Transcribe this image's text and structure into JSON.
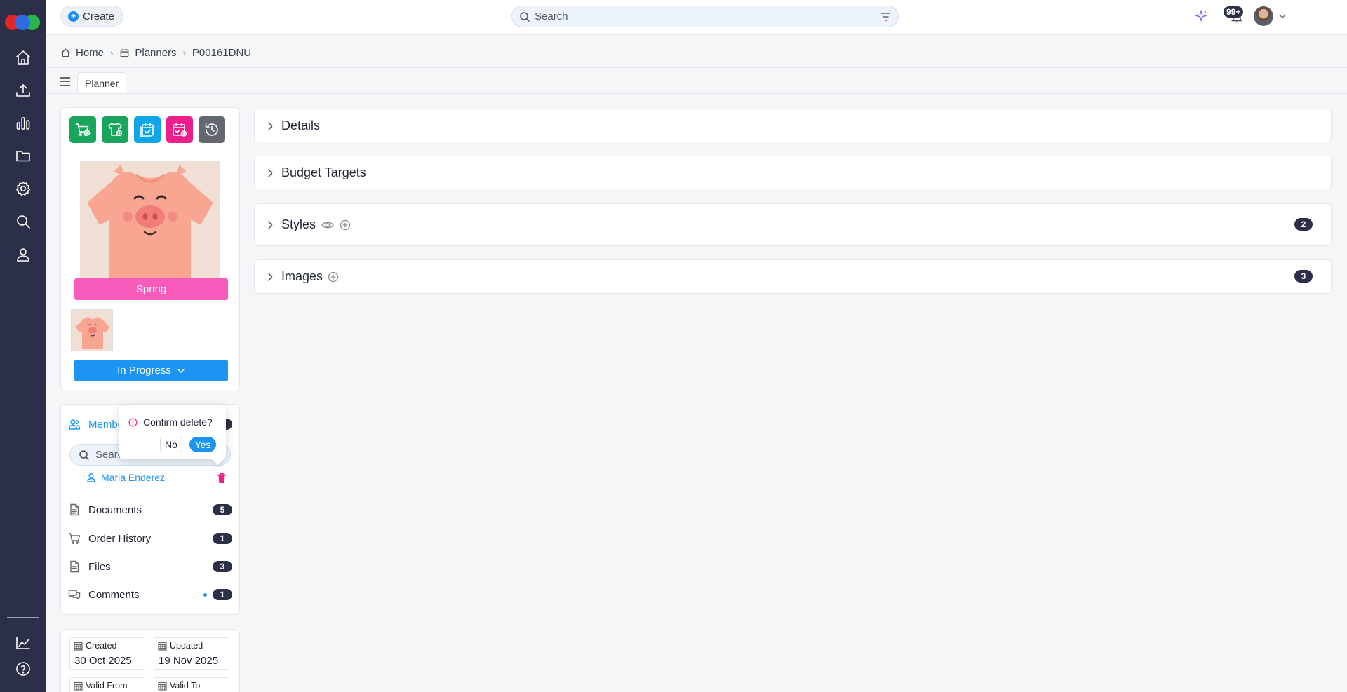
{
  "topbar": {
    "create_label": "Create",
    "search_placeholder": "Search",
    "notifications_count": "99+"
  },
  "breadcrumb": {
    "home": "Home",
    "planners": "Planners",
    "current": "P00161DNU"
  },
  "tabs": {
    "planner": "Planner"
  },
  "planner": {
    "season": "Spring",
    "status": "In Progress"
  },
  "nav": {
    "members_label": "Members",
    "member_search_placeholder": "Search",
    "member_name": "Maria Enderez",
    "documents_label": "Documents",
    "documents_count": "5",
    "order_history_label": "Order History",
    "order_history_count": "1",
    "files_label": "Files",
    "files_count": "3",
    "comments_label": "Comments",
    "comments_count": "1"
  },
  "popconfirm": {
    "message": "Confirm delete?",
    "no_label": "No",
    "yes_label": "Yes"
  },
  "dates": {
    "created_label": "Created",
    "created_value": "30 Oct 2025",
    "updated_label": "Updated",
    "updated_value": "19 Nov 2025",
    "valid_from_label": "Valid From",
    "valid_to_label": "Valid To"
  },
  "sections": {
    "details": "Details",
    "budget_targets": "Budget Targets",
    "styles": "Styles",
    "styles_count": "2",
    "images": "Images",
    "images_count": "3"
  },
  "colors": {
    "rail": "#2b2f47",
    "accent_blue": "#1b94f2",
    "season_pink": "#f95bbd",
    "action_green": "#19a55b",
    "action_teal": "#0ea5e9",
    "action_magenta": "#ee1f8c",
    "action_gray": "#636870"
  },
  "icons": {
    "rail": [
      "home-icon",
      "upload-icon",
      "bar-chart-icon",
      "folder-icon",
      "settings-icon",
      "search-icon",
      "user-icon",
      "analytics-icon",
      "help-icon"
    ],
    "actions": [
      "cart-add-icon",
      "shirt-add-icon",
      "calendar-check-icon",
      "calendar-add-icon",
      "history-icon"
    ]
  }
}
